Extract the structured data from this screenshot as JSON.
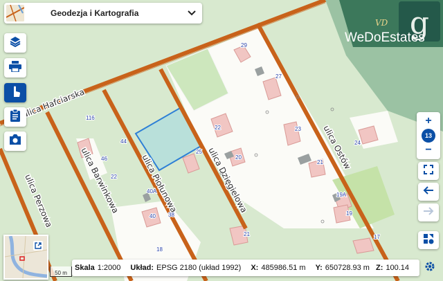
{
  "layer_selector": {
    "label": "Geodezja i Kartografia"
  },
  "logo": {
    "brand": "WeDoEstates",
    "mark": "VD"
  },
  "streets": {
    "hafciarska": "ulica Hafciarska",
    "perzowa": "ulica Perzowa",
    "barwinkowa": "ulica Barwinkowa",
    "piolunowa": "ulica Piołunowa",
    "dziegielowa": "ulica Dzięgielowa",
    "ostow": "ulica Ostów"
  },
  "house_numbers": [
    "29",
    "27",
    "116",
    "44",
    "46",
    "22",
    "25",
    "22",
    "20",
    "23",
    "21",
    "24",
    "40A",
    "40",
    "38",
    "18",
    "19A",
    "19",
    "17",
    "21"
  ],
  "zoom": {
    "level": "13",
    "in": "+",
    "out": "−"
  },
  "scale_bar": {
    "label": "50 m"
  },
  "status": {
    "scale_label": "Skala",
    "scale_value": "1:2000",
    "crs_label": "Układ:",
    "crs_value": "EPSG 2180 (układ 1992)",
    "x_label": "X:",
    "x_value": "485986.51 m",
    "y_label": "Y:",
    "y_value": "650728.93 m",
    "z_label": "Z:",
    "z_value": "100.14"
  },
  "icons": [
    "layers-icon",
    "print-icon",
    "touch-icon",
    "clipboard-icon",
    "camera-icon",
    "fullscreen-icon",
    "back-arrow-icon",
    "forward-arrow-icon",
    "basemap-icon",
    "gear-icon",
    "external-link-icon",
    "chevron-down-icon"
  ],
  "colors": {
    "road": "#c8621a",
    "parcel_highlight": "#2d7fd6",
    "button_blue": "#0b4fa6",
    "logo_bg": "#2c6b4f"
  }
}
